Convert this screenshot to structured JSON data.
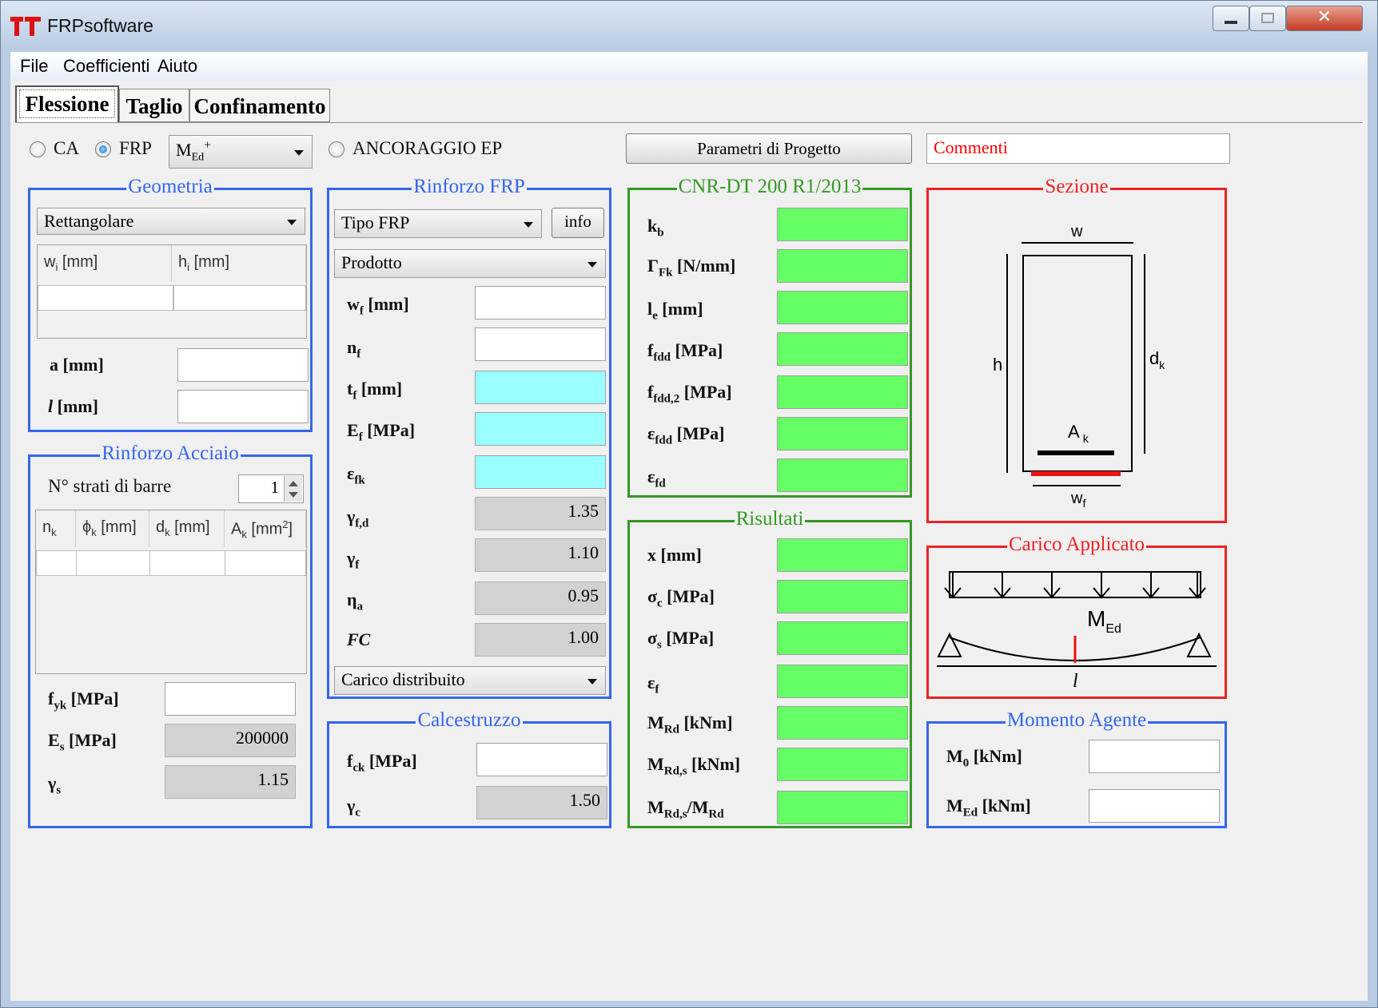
{
  "window": {
    "title": "FRPsoftware"
  },
  "menu": [
    "File",
    "Coefficienti",
    "Aiuto"
  ],
  "tabs": [
    "Flessione",
    "Taglio",
    "Confinamento"
  ],
  "top": {
    "radio_ca": "CA",
    "radio_frp": "FRP",
    "moment_select": "MEd+",
    "radio_ancoraggio": "ANCORAGGIO EP",
    "params_button": "Parametri di Progetto",
    "comments": "Commenti"
  },
  "geometria": {
    "title": "Geometria",
    "shape": "Rettangolare",
    "col_w": "wi [mm]",
    "col_h": "hi [mm]",
    "a_label": "a [mm]",
    "l_label": "l [mm]"
  },
  "acciaio": {
    "title": "Rinforzo Acciaio",
    "layers_label": "N° strati di barre",
    "layers_value": "1",
    "cols": [
      "nk",
      "ϕk [mm]",
      "dk [mm]",
      "Ak [mm2]"
    ],
    "fyk_label": "fyk [MPa]",
    "es_label": "Es [MPa]",
    "es_value": "200000",
    "gs_label": "γs",
    "gs_value": "1.15"
  },
  "frp": {
    "title": "Rinforzo FRP",
    "type": "Tipo FRP",
    "info": "info",
    "product": "Prodotto",
    "wf": "wf [mm]",
    "nf": "nf",
    "tf": "tf [mm]",
    "ef": "Ef [MPa]",
    "efk": "εfk",
    "gfd": "γf,d",
    "gfd_value": "1.35",
    "gf": "γf",
    "gf_value": "1.10",
    "eta": "ηa",
    "eta_value": "0.95",
    "fc": "FC",
    "fc_value": "1.00",
    "load": "Carico distribuito"
  },
  "calcestruzzo": {
    "title": "Calcestruzzo",
    "fck": "fck [MPa]",
    "gc": "γc",
    "gc_value": "1.50"
  },
  "cnr": {
    "title": "CNR-DT 200 R1/2013",
    "kb": "kb",
    "gfk": "ΓFk [N/mm]",
    "le": "le [mm]",
    "ffdd": "ffdd [MPa]",
    "ffdd2": "ffdd,2 [MPa]",
    "efdd": "εfdd [MPa]",
    "efd": "εfd"
  },
  "risultati": {
    "title": "Risultati",
    "x": "x [mm]",
    "sc": "σc [MPa]",
    "ss": "σs [MPa]",
    "ef": "εf",
    "mrd": "MRd [kNm]",
    "mrds": "MRd,s [kNm]",
    "ratio": "MRd,s/MRd"
  },
  "sezione": {
    "title": "Sezione",
    "w": "w",
    "h": "h",
    "dk": "dk",
    "ak": "Ak",
    "wf": "wf"
  },
  "carico": {
    "title": "Carico Applicato",
    "med": "MEd",
    "l": "l"
  },
  "momento": {
    "title": "Momento Agente",
    "m0": "M0 [kNm]",
    "med": "MEd [kNm]"
  },
  "colors": {
    "blue": "#3366ee",
    "green": "#339922",
    "red": "#ee2222",
    "result_fill": "#66ff66",
    "input_cyan": "#99ffff"
  }
}
